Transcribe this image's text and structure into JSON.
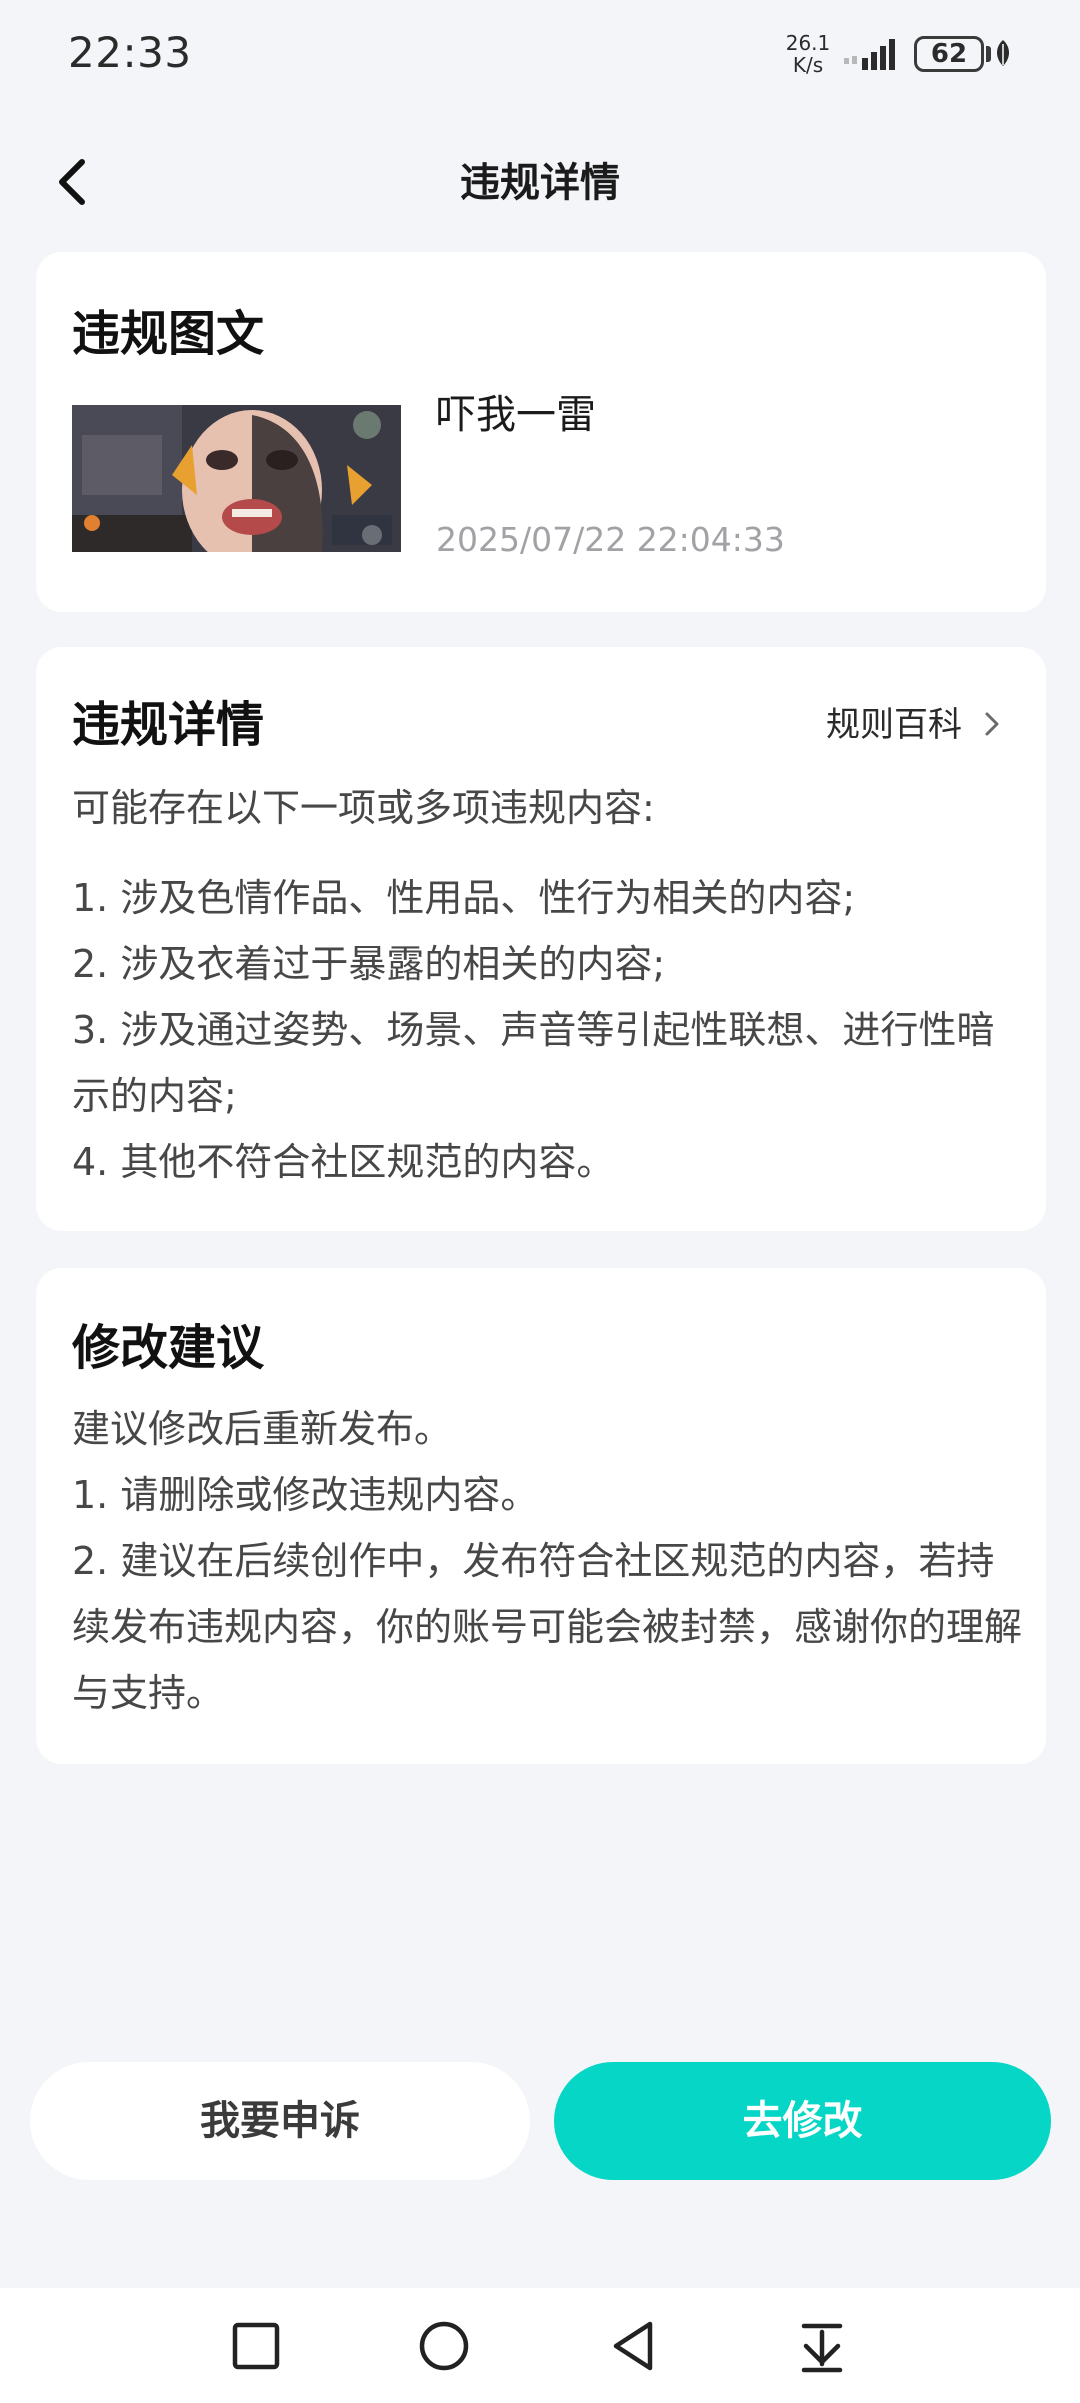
{
  "status_bar": {
    "time": "22:33",
    "net_speed_value": "26.1",
    "net_speed_unit": "K/s",
    "battery": "62",
    "icons": [
      "signal-icon",
      "battery-icon",
      "eco-leaf-icon"
    ]
  },
  "header": {
    "title": "违规详情",
    "back_icon": "chevron-left-icon"
  },
  "post_card": {
    "title": "违规图文",
    "caption": "吓我一雷",
    "timestamp": "2025/07/22 22:04:33"
  },
  "detail_card": {
    "title": "违规详情",
    "rules_link": "规则百科",
    "intro": "可能存在以下一项或多项违规内容:",
    "items": [
      "1. 涉及色情作品、性用品、性行为相关的内容;",
      "2. 涉及衣着过于暴露的相关的内容;",
      "3. 涉及通过姿势、场景、声音等引起性联想、进行性暗示的内容;",
      "4. 其他不符合社区规范的内容。"
    ]
  },
  "suggest_card": {
    "title": "修改建议",
    "lines": [
      "建议修改后重新发布。",
      "1. 请删除或修改违规内容。",
      "2. 建议在后续创作中，发布符合社区规范的内容，若持续发布违规内容，你的账号可能会被封禁，感谢你的理解与支持。"
    ]
  },
  "actions": {
    "appeal": "我要申诉",
    "modify": "去修改"
  },
  "colors": {
    "accent": "#06d6c5",
    "background": "#f4f5f9",
    "card": "#ffffff",
    "muted_text": "#a2a2a6"
  },
  "system_nav": {
    "icons": [
      "recent-apps-square-icon",
      "home-circle-icon",
      "back-triangle-icon",
      "notification-pull-down-icon"
    ]
  }
}
